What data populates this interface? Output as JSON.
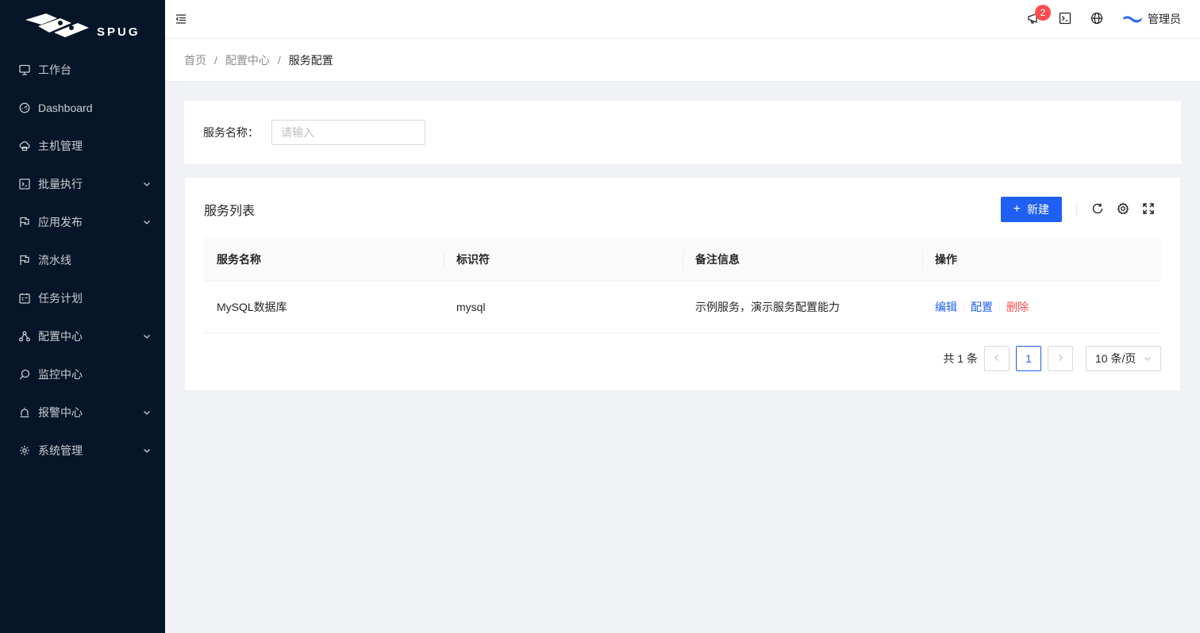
{
  "app": {
    "logo_text": "SPUG"
  },
  "sidebar": {
    "items": [
      {
        "label": "工作台",
        "icon": "desktop-icon",
        "submenu": false
      },
      {
        "label": "Dashboard",
        "icon": "dashboard-icon",
        "submenu": false
      },
      {
        "label": "主机管理",
        "icon": "cloud-server-icon",
        "submenu": false
      },
      {
        "label": "批量执行",
        "icon": "code-icon",
        "submenu": true
      },
      {
        "label": "应用发布",
        "icon": "flag-icon",
        "submenu": true
      },
      {
        "label": "流水线",
        "icon": "flag-icon",
        "submenu": false
      },
      {
        "label": "任务计划",
        "icon": "schedule-icon",
        "submenu": false
      },
      {
        "label": "配置中心",
        "icon": "deployment-unit-icon",
        "submenu": true
      },
      {
        "label": "监控中心",
        "icon": "monitor-icon",
        "submenu": false
      },
      {
        "label": "报警中心",
        "icon": "alert-icon",
        "submenu": true
      },
      {
        "label": "系统管理",
        "icon": "setting-icon",
        "submenu": true
      }
    ]
  },
  "header": {
    "notification_count": "2",
    "user_name": "管理员"
  },
  "breadcrumb": {
    "items": [
      "首页",
      "配置中心",
      "服务配置"
    ]
  },
  "search": {
    "label": "服务名称：",
    "placeholder": "请输入"
  },
  "table_card": {
    "title": "服务列表",
    "new_button": "新建",
    "columns": [
      "服务名称",
      "标识符",
      "备注信息",
      "操作"
    ],
    "rows": [
      {
        "name": "MySQL数据库",
        "key": "mysql",
        "desc": "示例服务，演示服务配置能力",
        "actions": [
          "编辑",
          "配置",
          "删除"
        ]
      }
    ],
    "pagination": {
      "total_text": "共 1 条",
      "current_page": "1",
      "page_size": "10 条/页"
    }
  },
  "colors": {
    "accent": "#1f5ff4",
    "danger": "#ff4d4f",
    "sider_bg": "#061528"
  }
}
